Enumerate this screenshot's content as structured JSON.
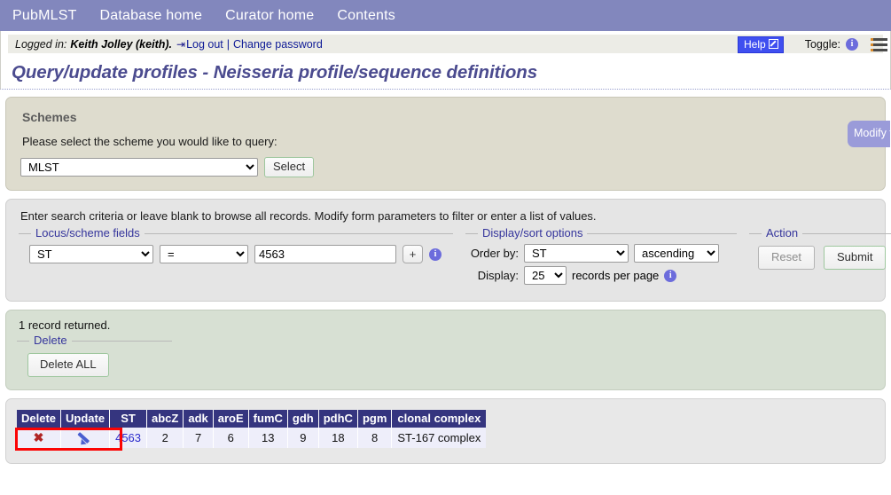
{
  "navbar": {
    "items": [
      {
        "label": "PubMLST"
      },
      {
        "label": "Database home"
      },
      {
        "label": "Curator home"
      },
      {
        "label": "Contents"
      }
    ]
  },
  "login_bar": {
    "prefix": "Logged in:",
    "user": "Keith Jolley (keith).",
    "logout_label": "Log out",
    "separator": "|",
    "change_password_label": "Change password",
    "help_label": "Help",
    "help_icon": "external-link-icon",
    "toggle_label": "Toggle:",
    "toggle_info_icon": "info-icon",
    "menu_icon": "hamburger-menu-icon"
  },
  "page": {
    "title": "Query/update profiles - Neisseria profile/sequence definitions"
  },
  "schemes_panel": {
    "heading": "Schemes",
    "instruction": "Please select the scheme you would like to query:",
    "scheme_value": "MLST",
    "scheme_options": [
      "MLST"
    ],
    "select_button": "Select",
    "modify_tab_label": "Modify form options"
  },
  "search_panel": {
    "instruction": "Enter search criteria or leave blank to browse all records. Modify form parameters to filter or enter a list of values.",
    "locus_legend": "Locus/scheme fields",
    "field_value": "ST",
    "field_options": [
      "ST"
    ],
    "operator_value": "=",
    "operator_options": [
      "="
    ],
    "search_value": "4563",
    "search_placeholder": "",
    "add_button": "+",
    "locus_info_icon": "info-icon",
    "display_legend": "Display/sort options",
    "order_by_label": "Order by:",
    "order_by_value": "ST",
    "order_by_options": [
      "ST"
    ],
    "direction_value": "ascending",
    "direction_options": [
      "ascending"
    ],
    "display_label": "Display:",
    "display_value": "25",
    "display_options": [
      "25"
    ],
    "records_per_page_label": "records per page",
    "display_info_icon": "info-icon",
    "action_legend": "Action",
    "reset_button": "Reset",
    "submit_button": "Submit"
  },
  "results_panel": {
    "record_count_text": "1 record returned.",
    "delete_legend": "Delete",
    "delete_all_button": "Delete ALL"
  },
  "results_table": {
    "headers": [
      "Delete",
      "Update",
      "ST",
      "abcZ",
      "adk",
      "aroE",
      "fumC",
      "gdh",
      "pdhC",
      "pgm",
      "clonal complex"
    ],
    "rows": [
      {
        "delete_icon": "delete-x-icon",
        "update_icon": "edit-pencil-icon",
        "st": "4563",
        "abcZ": "2",
        "adk": "7",
        "aroE": "6",
        "fumC": "13",
        "gdh": "9",
        "pdhC": "18",
        "pgm": "8",
        "clonal_complex": "ST-167 complex"
      }
    ]
  },
  "colors": {
    "navbar": "#8287bd",
    "title": "#4b4b8f",
    "help_button": "#3f4ff0",
    "table_header": "#35357f",
    "link": "#2b2bcc",
    "annotation_box": "#fb0404",
    "schemes_panel": "#dedcce",
    "search_panel": "#e5e5e5",
    "results_panel": "#d7e0d3",
    "modify_tab": "#9a9bd9"
  }
}
